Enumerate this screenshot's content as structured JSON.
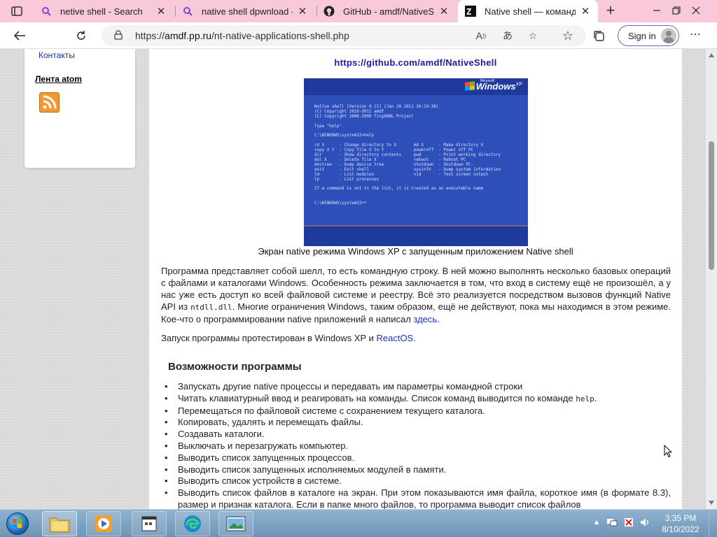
{
  "browser": {
    "tabs": [
      {
        "title": "netive shell - Search",
        "favicon": "search-icon",
        "active": false
      },
      {
        "title": "native shell dpwnload - Search",
        "favicon": "search-icon",
        "active": false
      },
      {
        "title": "GitHub - amdf/NativeShell",
        "favicon": "github-icon",
        "active": false
      },
      {
        "title": "Native shell — командная строка",
        "favicon": "site-icon",
        "active": true
      }
    ],
    "address": {
      "scheme": "https://",
      "host": "amdf.pp.ru",
      "path": "/nt-native-applications-shell.php"
    },
    "signin_label": "Sign in",
    "colors": {
      "tabstrip": "#f8c9d9",
      "accent": "#7a5fc0"
    }
  },
  "sidebar": {
    "contacts_label": "Контакты",
    "atom_label": "Лента atom",
    "rss_icon": "rss-icon"
  },
  "article": {
    "github_link": "https://github.com/amdf/NativeShell",
    "screenshot": {
      "logo_ms": "Microsoft",
      "logo": "Windows",
      "logo_sup": "XP",
      "console": "Native shell [Version 0.11] (Jan 26 2011 20:19:38)\n(C) Copyright 2010-2011 amdf\n(C) Copyright 2006-2009 TinyKRNL Project\n\nType \"help\".\n\nC:\\WINDOWS\\system32>help\n\ncd X      - Change directory to X       md X      - Make directory X\ncopy X Y  - Copy file X to Y            poweroff  - Power off PC\ndir       - Show directory contents     pwd       - Print working directory\ndel X     - Delete file X               reboot    - Reboot PC\ndevtree   - Dump device tree            shutdown  - Shutdown PC\nexit      - Exit shell                  sysinfo   - Dump system information\nlm        - List modules                vid       - Test screen output\nlp        - List processes\n\nIf a command is not in the list, it is treated as an executable name\n\n\nC:\\WINDOWS\\system32>*"
    },
    "caption": "Экран native режима Windows XP с запущенным приложением Native shell",
    "para1": {
      "before": "Программа представляет собой шелл, то есть командную строку. В ней можно выполнять несколько базовых операций с файлами и каталогами Windows. Особенность режима заключается в том, что вход в систему ещё не произошёл, а у нас уже есть доступ ко всей файловой системе и реестру. Всё это реализуется посредством вызовов функций Native API из ",
      "code": "ntdll.dll",
      "middle": ". Многие ограничения Windows, таким образом, ещё не действуют, пока мы находимся в этом режиме. Кое-что о программировании native приложений я написал ",
      "link": "здесь",
      "after": "."
    },
    "para2": {
      "before": "Запуск программы протестирован в Windows XP и ",
      "link": "ReactOS",
      "after": "."
    },
    "features_heading": "Возможности программы",
    "features": [
      {
        "text": "Запускать другие native процессы и передавать им параметры командной строки"
      },
      {
        "text": "Читать клавиатурный ввод и реагировать на команды. Список команд выводится по команде ",
        "code": "help",
        "tail": "."
      },
      {
        "text": "Перемещаться по файловой системе с сохранением текущего каталога."
      },
      {
        "text": "Копировать, удалять и перемещать файлы."
      },
      {
        "text": "Создавать каталоги."
      },
      {
        "text": "Выключать и перезагружать компьютер."
      },
      {
        "text": "Выводить список запущенных процессов."
      },
      {
        "text": "Выводить список запущенных исполняемых модулей в памяти."
      },
      {
        "text": "Выводить список устройств в системе."
      },
      {
        "text": "Выводить список файлов в каталоге на экран. При этом показываются имя файла, короткое имя (в формате 8.3), размер и признак каталога. Если в папке много файлов, то программа выводит список файлов"
      }
    ]
  },
  "taskbar": {
    "clock_time": "3:35 PM",
    "clock_date": "8/10/2022"
  }
}
